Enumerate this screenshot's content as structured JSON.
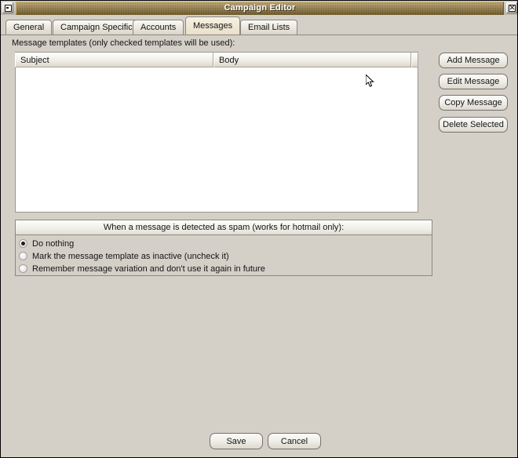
{
  "window": {
    "title": "Campaign Editor",
    "minimize_icon": "minimize-icon",
    "close_icon": "close-icon"
  },
  "tabs": [
    {
      "label": "General",
      "selected": false
    },
    {
      "label": "Campaign Specific",
      "selected": false
    },
    {
      "label": "Accounts",
      "selected": false
    },
    {
      "label": "Messages",
      "selected": true
    },
    {
      "label": "Email Lists",
      "selected": false
    }
  ],
  "main": {
    "section_label": "Message templates (only checked templates will be used):",
    "table": {
      "columns": [
        "Subject",
        "Body"
      ],
      "rows": []
    },
    "side_buttons": [
      "Add Message",
      "Edit Message",
      "Copy Message",
      "Delete Selected"
    ],
    "spam_group": {
      "title": "When a message is detected as spam (works for hotmail only):",
      "options": [
        {
          "label": "Do nothing",
          "selected": true
        },
        {
          "label": "Mark the message template as inactive (uncheck it)",
          "selected": false
        },
        {
          "label": "Remember message variation and don't use it again in future",
          "selected": false
        }
      ]
    }
  },
  "footer": {
    "save_label": "Save",
    "cancel_label": "Cancel"
  },
  "colors": {
    "window_background": "#d4d0c8",
    "titlebar_accent": "#9a7f3e",
    "selected_tab": "#eee7d3",
    "table_background": "#ffffff",
    "border": "#8d887d"
  }
}
